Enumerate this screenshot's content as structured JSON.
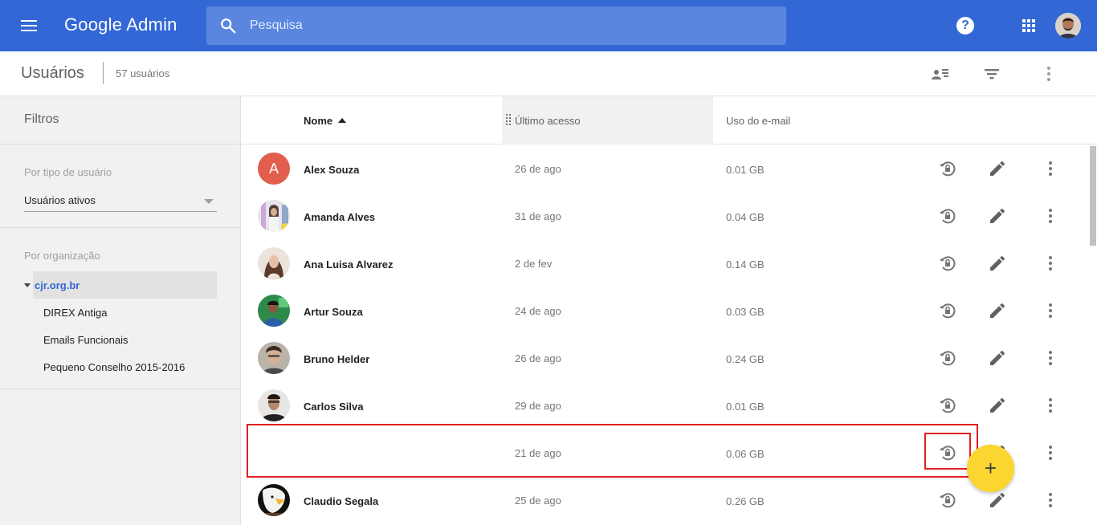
{
  "app": {
    "title": "Google Admin"
  },
  "search": {
    "placeholder": "Pesquisa"
  },
  "header": {
    "help_icon": "help-icon",
    "apps_icon": "apps-grid-icon",
    "account_icon": "account-avatar"
  },
  "subheader": {
    "title": "Usuários",
    "count": "57 usuários"
  },
  "sidebar": {
    "title": "Filtros",
    "user_type_label": "Por tipo de usuário",
    "user_type_value": "Usuários ativos",
    "org_label": "Por organização",
    "org_root": "cjr.org.br",
    "org_children": [
      "DIREX Antiga",
      "Emails Funcionais",
      "Pequeno Conselho 2015-2016"
    ]
  },
  "table": {
    "columns": {
      "name": "Nome",
      "last_access": "Último acesso",
      "email_usage": "Uso do e-mail"
    },
    "sort": "ascending",
    "rows": [
      {
        "name": "Alex Souza",
        "last_access": "26 de ago",
        "email_usage": "0.01 GB",
        "avatar_letter": "A"
      },
      {
        "name": "Amanda Alves",
        "last_access": "31 de ago",
        "email_usage": "0.04 GB"
      },
      {
        "name": "Ana Luisa Alvarez",
        "last_access": "2 de fev",
        "email_usage": "0.14 GB"
      },
      {
        "name": "Artur Souza",
        "last_access": "24 de ago",
        "email_usage": "0.03 GB"
      },
      {
        "name": "Bruno Helder",
        "last_access": "26 de ago",
        "email_usage": "0.24 GB"
      },
      {
        "name": "Carlos Silva",
        "last_access": "29 de ago",
        "email_usage": "0.01 GB"
      },
      {
        "name": "",
        "last_access": "21 de ago",
        "email_usage": "0.06 GB"
      },
      {
        "name": "Claudio Segala",
        "last_access": "25 de ago",
        "email_usage": "0.26 GB"
      }
    ]
  },
  "fab": {
    "label": "+"
  },
  "colors": {
    "brand": "#3367d6",
    "fab": "#fbd630",
    "highlight": "#e0201f",
    "link": "#3367d6"
  }
}
